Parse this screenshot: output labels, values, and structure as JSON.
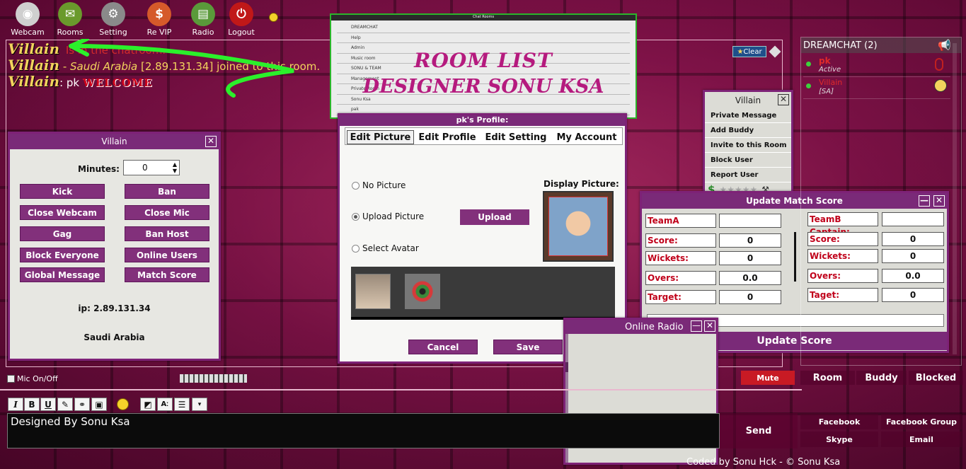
{
  "toolbar": [
    {
      "label": "Webcam",
      "icon": "webcam-icon",
      "color": "#cfcfcf"
    },
    {
      "label": "Rooms",
      "icon": "chat-bubble-icon",
      "color": "#6a9a2c"
    },
    {
      "label": "Setting",
      "icon": "gear-icon",
      "color": "#8a8a8a"
    },
    {
      "label": "Re VIP",
      "icon": "dollar-icon",
      "color": "#d55a2a"
    },
    {
      "label": "Radio",
      "icon": "radio-icon",
      "color": "#5a9a3a"
    },
    {
      "label": "Logout",
      "icon": "logout-icon",
      "color": "#c01818"
    }
  ],
  "chat": {
    "messages": [
      {
        "name": "Villain",
        "text": "Is in the chatroom."
      },
      {
        "name": "Villain",
        "sep": " - ",
        "country": "Saudi Arabia",
        "text": " [2.89.131.34] joined to this room."
      },
      {
        "name": "Villain",
        "text": ": pk ",
        "styled": "WELCOME"
      }
    ],
    "clear_label": "Clear"
  },
  "room_list_banner": {
    "title": "ROOM LIST",
    "subtitle": "DESIGNER SONU KSA",
    "window_title": "Chat Rooms",
    "rooms": [
      "DREAMCHAT",
      "Help",
      "Admin",
      "Music room",
      "SONU & TEAM",
      "Management",
      "Private Room",
      "Sonu Ksa",
      "pak"
    ]
  },
  "admin_panel": {
    "title": "Villain",
    "minutes_label": "Minutes:",
    "minutes_value": "0",
    "buttons": [
      "Kick",
      "Ban",
      "Close Webcam",
      "Close Mic",
      "Gag",
      "Ban Host",
      "Block Everyone",
      "Online Users",
      "Global Message",
      "Match Score"
    ],
    "ip": "ip: 2.89.131.34",
    "country": "Saudi Arabia"
  },
  "profile": {
    "title": "pk's Profile:",
    "tabs": [
      "Edit Picture",
      "Edit Profile",
      "Edit Setting",
      "My Account"
    ],
    "options": [
      "No Picture",
      "Upload Picture",
      "Select Avatar"
    ],
    "upload_label": "Upload",
    "display_label": "Display Picture:",
    "cancel_label": "Cancel",
    "save_label": "Save"
  },
  "user_menu": {
    "title": "Villain",
    "items": [
      "Private Message",
      "Add Buddy",
      "Invite to this Room",
      "Block User",
      "Report User"
    ],
    "rating_stars": "★★★★★"
  },
  "match_score": {
    "title": "Update Match Score",
    "teamA": {
      "captain": "TeamA",
      "score_label": "Score:",
      "score": "0",
      "wickets_label": "Wickets:",
      "wickets": "0",
      "overs_label": "Overs:",
      "overs": "0.0",
      "target_label": "Target:",
      "target": "0"
    },
    "teamB": {
      "captain_label": "TeamB Captain:",
      "score_label": "Score:",
      "score": "0",
      "wickets_label": "Wickets:",
      "wickets": "0",
      "overs_label": "Overs:",
      "overs": "0.0",
      "target_label": "Taget:",
      "target": "0"
    },
    "update_label": "Update Score"
  },
  "radio": {
    "title": "Online Radio"
  },
  "userlist": {
    "header": "DREAMCHAT (2)",
    "users": [
      {
        "name": "pk",
        "status": "Active"
      },
      {
        "name": "Villain",
        "status": "[SA]"
      }
    ]
  },
  "tabs_right": {
    "mute": "Mute",
    "room": "Room",
    "buddy": "Buddy",
    "blocked": "Blocked"
  },
  "mic_label": "Mic On/Off",
  "input": {
    "value": "Designed By Sonu Ksa"
  },
  "format_buttons": [
    "I",
    "B",
    "U"
  ],
  "send_label": "Send",
  "links": [
    "Facebook",
    "Facebook Group",
    "Skype",
    "Email"
  ],
  "footer": "Coded by Sonu Hck - © Sonu Ksa"
}
